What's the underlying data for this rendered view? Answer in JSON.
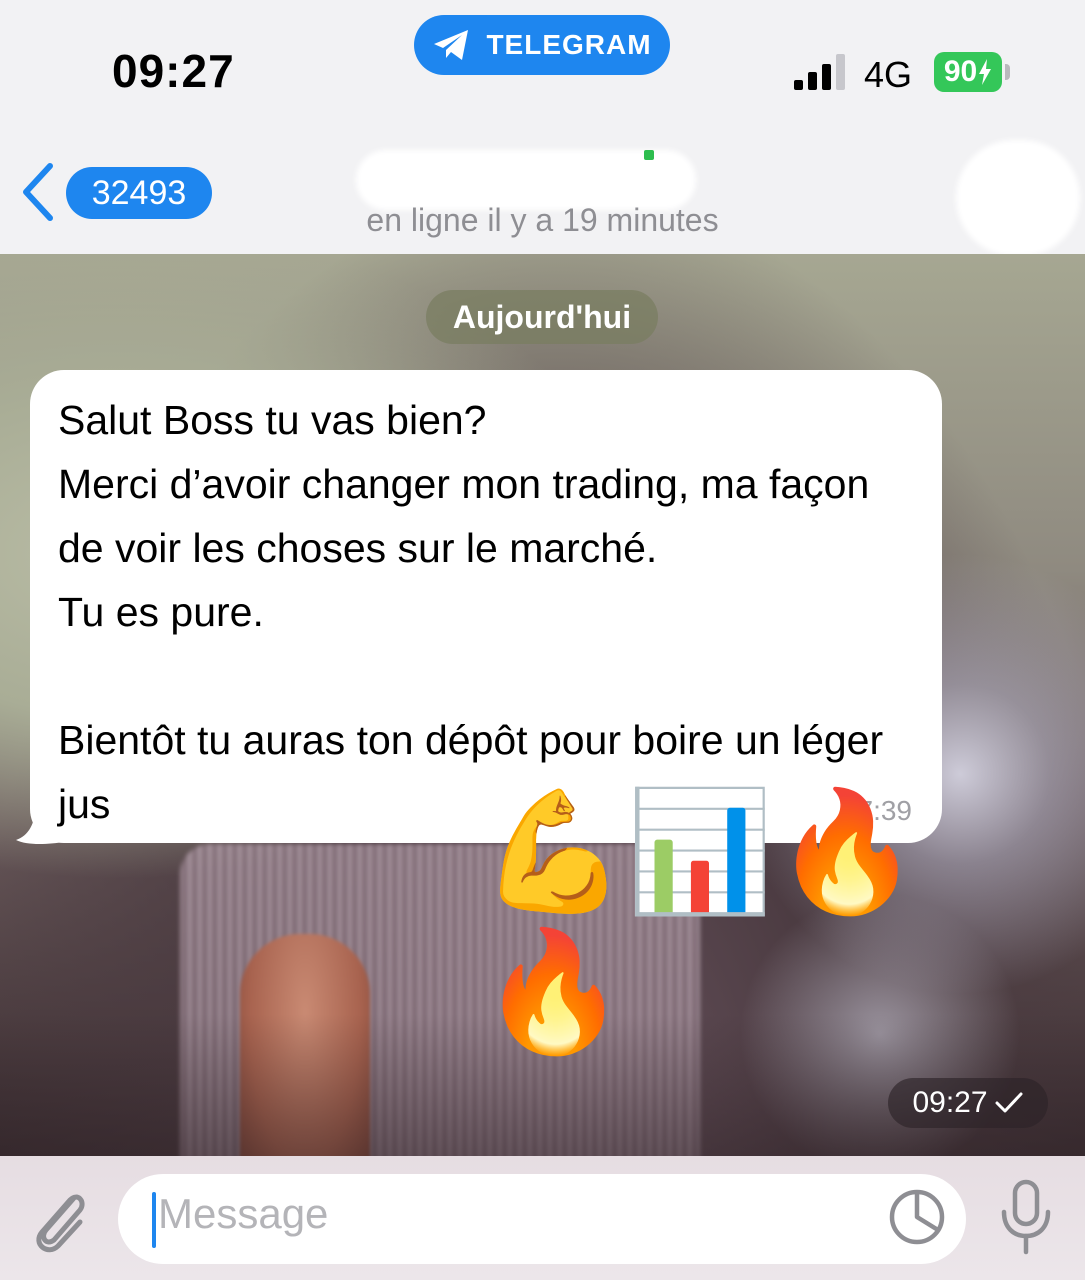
{
  "status_bar": {
    "time": "09:27",
    "app_name": "TELEGRAM",
    "network": "4G",
    "battery": "90"
  },
  "header": {
    "back_badge": "32493",
    "last_seen": "en ligne il y a 19 minutes"
  },
  "chat": {
    "date_separator": "Aujourd'hui",
    "messages": [
      {
        "text": "Salut Boss tu vas bien?\nMerci d’avoir changer mon trading, ma façon de voir les choses sur le marché.\nTu es pure.\n\nBientôt tu auras ton dépôt pour boire un léger jus",
        "time": "07:39"
      },
      {
        "emojis": "💪📊🔥🔥",
        "time": "09:27"
      }
    ]
  },
  "composer": {
    "placeholder": "Message"
  },
  "colors": {
    "accent": "#1e86ef",
    "battery": "#34c759"
  }
}
